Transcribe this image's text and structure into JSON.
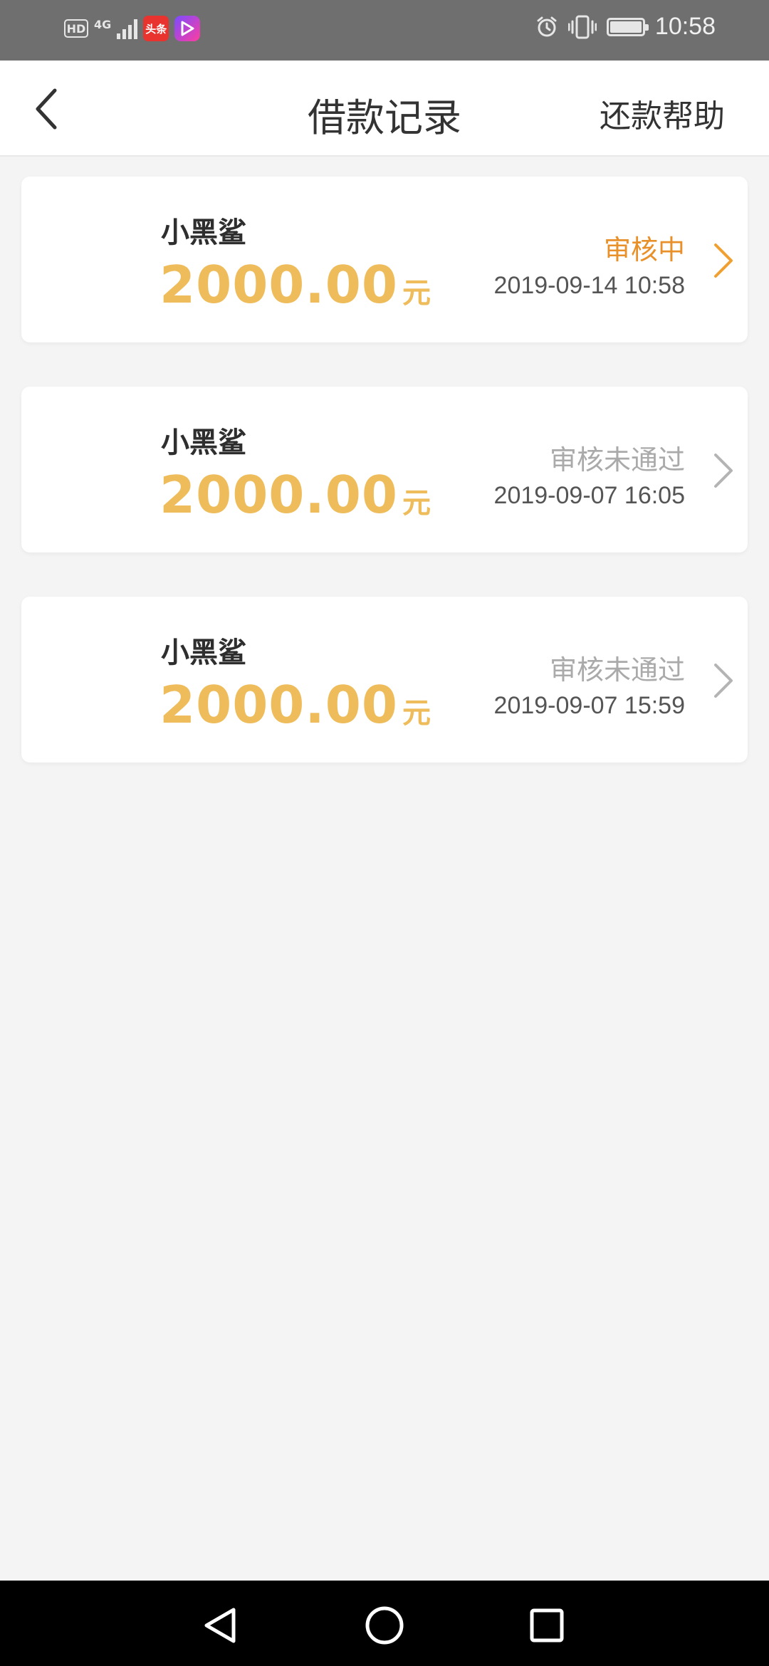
{
  "status_bar": {
    "time": "10:58",
    "left_badges": {
      "hd": "HD",
      "network": "4G",
      "app1": "头条"
    },
    "icons": [
      "hd-icon",
      "signal-icon",
      "toutiao-app-icon",
      "video-app-icon",
      "alarm-icon",
      "vibrate-icon",
      "battery-icon"
    ]
  },
  "header": {
    "title": "借款记录",
    "help_label": "还款帮助",
    "back_icon": "chevron-left-icon"
  },
  "records": [
    {
      "name": "小黑鲨",
      "amount": "2000.00",
      "unit": "元",
      "status": "审核中",
      "status_color": "#e8912a",
      "date": "2019-09-14 10:58",
      "chevron_color": "#f0a030"
    },
    {
      "name": "小黑鲨",
      "amount": "2000.00",
      "unit": "元",
      "status": "审核未通过",
      "status_color": "#aaaaaa",
      "date": "2019-09-07 16:05",
      "chevron_color": "#b4b4b4"
    },
    {
      "name": "小黑鲨",
      "amount": "2000.00",
      "unit": "元",
      "status": "审核未通过",
      "status_color": "#aaaaaa",
      "date": "2019-09-07 15:59",
      "chevron_color": "#b4b4b4"
    }
  ],
  "colors": {
    "amount": "#eebc5a",
    "background": "#f4f4f4"
  },
  "nav_bar": {
    "buttons": [
      "back-triangle-icon",
      "home-circle-icon",
      "recents-square-icon"
    ]
  }
}
